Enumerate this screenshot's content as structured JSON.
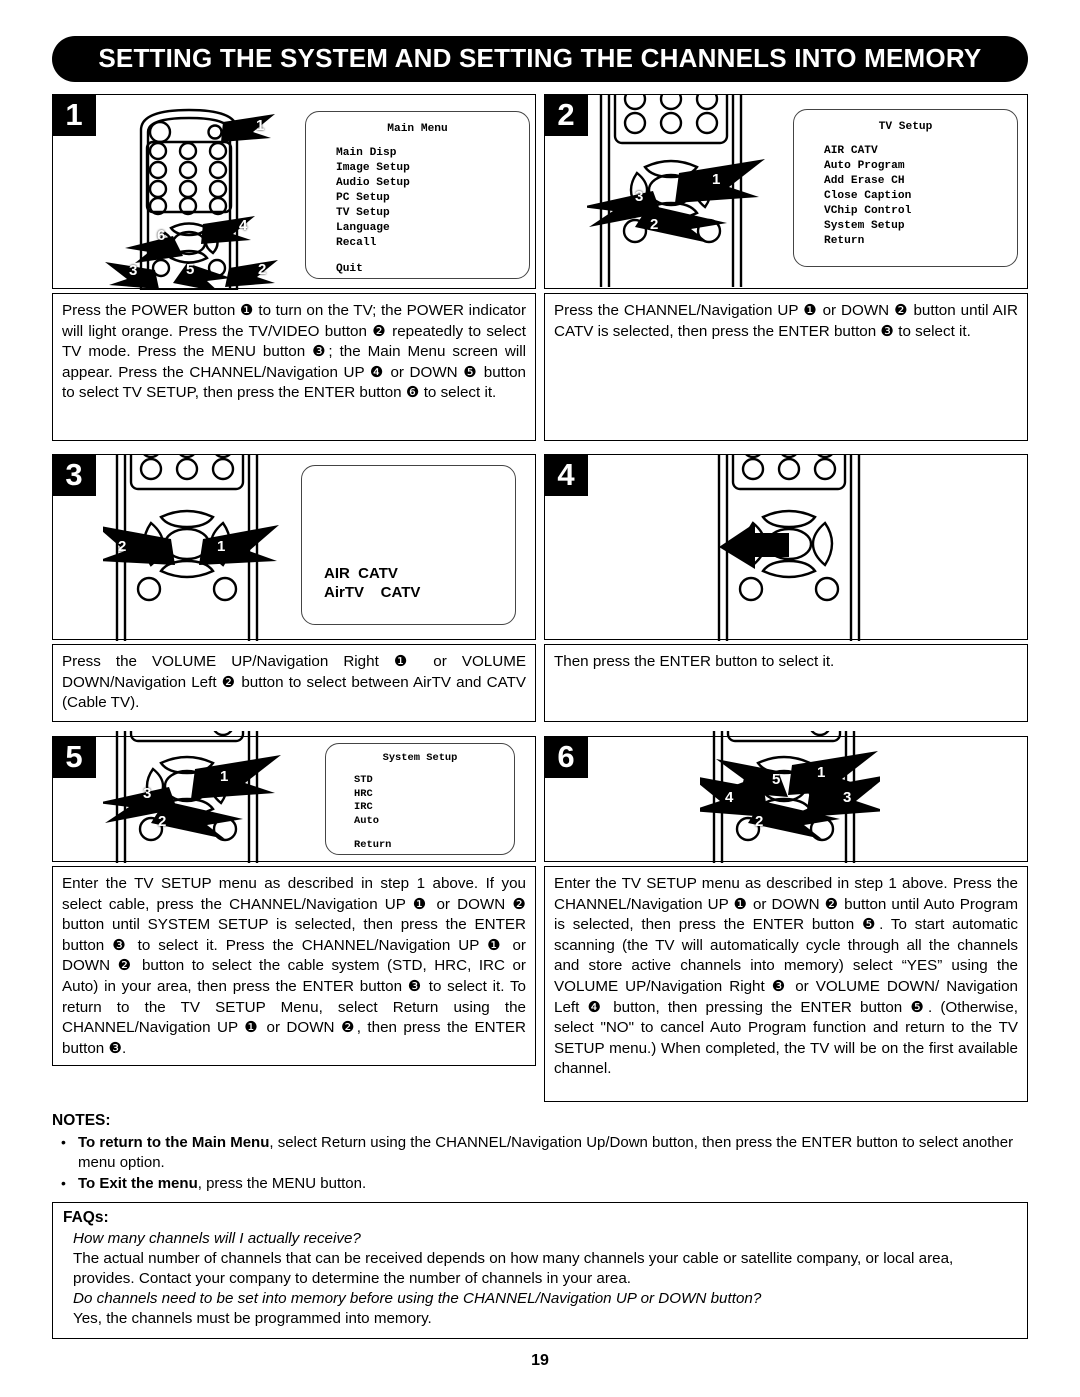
{
  "document": {
    "title": "SETTING THE SYSTEM AND SETTING THE CHANNELS INTO MEMORY",
    "page_number": "19"
  },
  "steps": [
    {
      "badge": "1",
      "figure": {
        "remote_name": "remote-control-diagram",
        "callouts": [
          "1",
          "2",
          "3",
          "4",
          "5",
          "6"
        ],
        "osd": {
          "name": "main-menu-screen",
          "title": "Main Menu",
          "items": [
            "Main Disp",
            "Image Setup",
            "Audio Setup",
            "PC Setup",
            "TV Setup",
            "Language",
            "Recall"
          ],
          "footer": "Quit"
        }
      },
      "text": "Press the POWER button ❶ to turn on the TV; the POWER indicator will light orange. Press the TV/VIDEO button ❷ repeatedly to select TV mode. Press the MENU button ❸; the Main Menu screen will appear. Press the CHANNEL/Navigation UP ❹ or DOWN ❺ button to select TV SETUP, then press the ENTER button ❻ to select it."
    },
    {
      "badge": "2",
      "figure": {
        "remote_name": "remote-control-diagram",
        "callouts": [
          "1",
          "2",
          "3"
        ],
        "osd": {
          "name": "tv-setup-menu-screen",
          "title": "TV Setup",
          "items": [
            "AIR CATV",
            "Auto Program",
            "Add Erase CH",
            "Close Caption",
            "VChip Control",
            "System Setup",
            "Return"
          ],
          "footer": ""
        }
      },
      "text": "Press the CHANNEL/Navigation UP ❶ or DOWN ❷ button until AIR CATV is selected, then press the ENTER button ❸ to select it."
    },
    {
      "badge": "3",
      "figure": {
        "remote_name": "remote-control-diagram",
        "callouts": [
          "1",
          "2"
        ],
        "osd": {
          "name": "air-catv-selection-screen",
          "title": "",
          "items": [],
          "line1": "AIR  CATV",
          "line2": "AirTV    CATV"
        }
      },
      "text": "Press the VOLUME UP/Navigation Right ❶ or VOLUME DOWN/Navigation Left ❷ button to select between AirTV and CATV (Cable TV)."
    },
    {
      "badge": "4",
      "figure": {
        "remote_name": "remote-control-diagram",
        "callouts": []
      },
      "text": "Then press the ENTER button to select it."
    },
    {
      "badge": "5",
      "figure": {
        "remote_name": "remote-control-diagram",
        "callouts": [
          "1",
          "2",
          "3"
        ],
        "osd": {
          "name": "system-setup-menu-screen",
          "title": "System Setup",
          "items": [
            "STD",
            "HRC",
            "IRC",
            "Auto"
          ],
          "footer": "Return"
        }
      },
      "text": "Enter the TV SETUP menu as described in step 1 above. If you select cable, press the CHANNEL/Navigation UP ❶ or DOWN ❷ button until SYSTEM SETUP is selected, then press the ENTER button ❸ to select it. Press the CHANNEL/Navigation UP ❶ or DOWN ❷ button to select the cable system (STD, HRC, IRC or Auto) in your area, then press the ENTER button ❸ to select it. To return to the TV SETUP Menu, select Return using the CHANNEL/Navigation UP ❶ or DOWN ❷, then press the ENTER button ❸."
    },
    {
      "badge": "6",
      "figure": {
        "remote_name": "remote-control-diagram",
        "callouts": [
          "1",
          "2",
          "3",
          "4",
          "5"
        ]
      },
      "text": "Enter the TV SETUP menu as described in step 1 above. Press the CHANNEL/Navigation UP ❶ or DOWN ❷ button until Auto Program is selected, then press the ENTER button ❺. To start automatic scanning (the TV will automatically cycle through all the channels and store active channels into memory) select “YES” using the VOLUME UP/Navigation Right ❸ or VOLUME DOWN/ Navigation Left ❹ button, then pressing the ENTER button ❺. (Otherwise, select \"NO\" to cancel Auto Program function and return to the TV SETUP menu.)  When completed, the TV will be on the first available channel."
    }
  ],
  "notes": {
    "heading": "NOTES:",
    "items": [
      {
        "bold": "To return to the Main Menu",
        "rest": ", select Return using the CHANNEL/Navigation Up/Down button, then press the ENTER button to select another menu option."
      },
      {
        "bold": "To Exit the menu",
        "rest": ", press the MENU button."
      }
    ]
  },
  "faqs": {
    "heading": "FAQs:",
    "entries": [
      {
        "question": "How many channels will I actually receive?",
        "answer": "The actual number of channels that can be received depends on how many channels your cable or satellite company, or local area, provides. Contact your company to determine the number of channels in your area."
      },
      {
        "question": "Do channels need to be set into memory before using the CHANNEL/Navigation UP or DOWN button?",
        "answer": "Yes, the channels must be programmed into memory."
      }
    ]
  }
}
